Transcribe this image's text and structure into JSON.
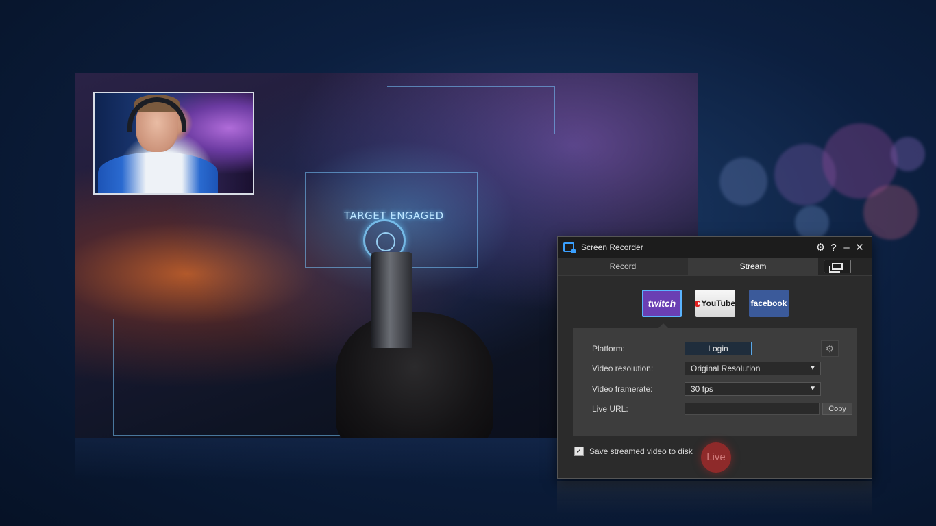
{
  "recorder": {
    "title": "Screen Recorder",
    "icons": {
      "settings": "gear-icon",
      "help": "?",
      "minimize": "–",
      "close": "✕"
    },
    "tabs": [
      {
        "label": "Record"
      },
      {
        "label": "Stream"
      }
    ],
    "active_tab": "Stream",
    "platforms": [
      {
        "name": "twitch",
        "label": "twitch",
        "selected": true
      },
      {
        "name": "youtube",
        "label": "YouTube",
        "selected": false
      },
      {
        "name": "facebook",
        "label": "facebook",
        "selected": false
      }
    ],
    "fields": {
      "platform_label": "Platform:",
      "login_label": "Login",
      "resolution_label": "Video resolution:",
      "resolution_value": "Original Resolution",
      "framerate_label": "Video framerate:",
      "framerate_value": "30 fps",
      "live_url_label": "Live URL:",
      "live_url_value": "",
      "copy_label": "Copy"
    },
    "save_to_disk": {
      "label": "Save streamed video to disk",
      "checked": true
    },
    "live_label": "Live"
  },
  "game": {
    "hud_text": "TARGET ENGAGED"
  },
  "colors": {
    "accent": "#5ab4ff",
    "twitch": "#6a3fb3",
    "facebook": "#3b5a9a",
    "live": "#8e2a2a"
  }
}
